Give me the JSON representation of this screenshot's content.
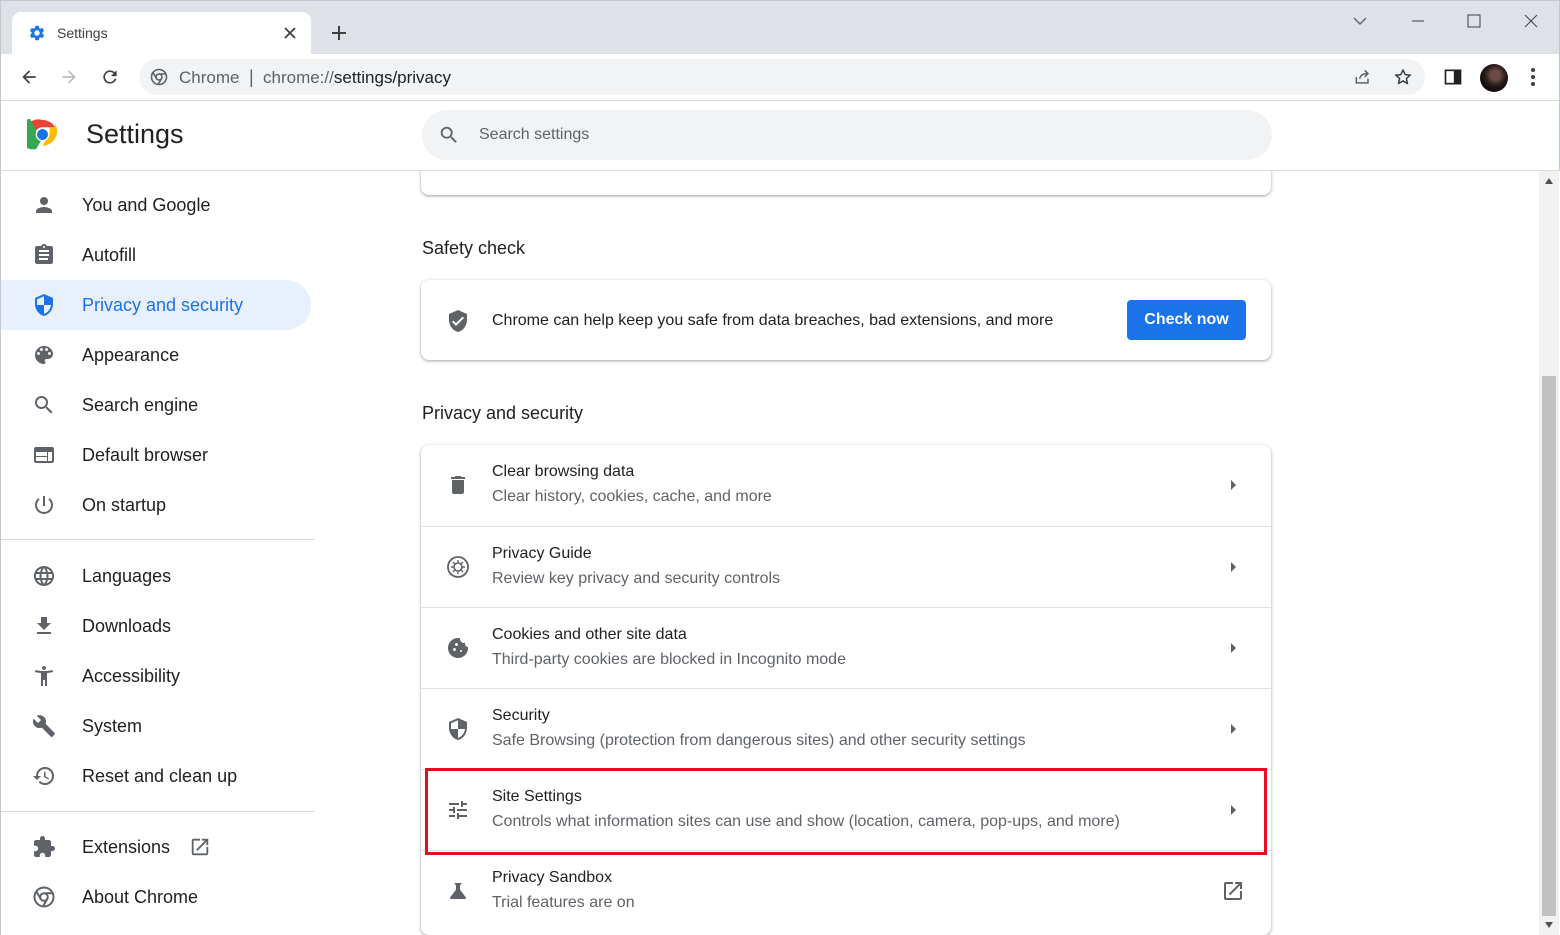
{
  "tab": {
    "title": "Settings",
    "favicon": "gear-icon"
  },
  "toolbar": {
    "site_name": "Chrome",
    "separator": "|",
    "url_scheme": "chrome://",
    "url_path": "settings/privacy"
  },
  "header": {
    "title": "Settings",
    "search_placeholder": "Search settings"
  },
  "sidebar": {
    "items": [
      {
        "label": "You and Google",
        "icon": "person-icon"
      },
      {
        "label": "Autofill",
        "icon": "clipboard-icon"
      },
      {
        "label": "Privacy and security",
        "icon": "shield-icon",
        "active": true
      },
      {
        "label": "Appearance",
        "icon": "palette-icon"
      },
      {
        "label": "Search engine",
        "icon": "search-icon"
      },
      {
        "label": "Default browser",
        "icon": "browser-window-icon"
      },
      {
        "label": "On startup",
        "icon": "power-icon"
      },
      {
        "label": "Languages",
        "icon": "globe-icon"
      },
      {
        "label": "Downloads",
        "icon": "download-icon"
      },
      {
        "label": "Accessibility",
        "icon": "accessibility-icon"
      },
      {
        "label": "System",
        "icon": "wrench-icon"
      },
      {
        "label": "Reset and clean up",
        "icon": "restore-icon"
      },
      {
        "label": "Extensions",
        "icon": "puzzle-icon"
      },
      {
        "label": "About Chrome",
        "icon": "chrome-logo-icon"
      }
    ]
  },
  "safety_check": {
    "title": "Safety check",
    "text": "Chrome can help keep you safe from data breaches, bad extensions, and more",
    "button": "Check now",
    "button_color": "#1a73e8"
  },
  "privacy": {
    "title": "Privacy and security",
    "rows": [
      {
        "title": "Clear browsing data",
        "subtitle": "Clear history, cookies, cache, and more",
        "icon": "trash-icon"
      },
      {
        "title": "Privacy Guide",
        "subtitle": "Review key privacy and security controls",
        "icon": "compass-icon"
      },
      {
        "title": "Cookies and other site data",
        "subtitle": "Third-party cookies are blocked in Incognito mode",
        "icon": "cookie-icon"
      },
      {
        "title": "Security",
        "subtitle": "Safe Browsing (protection from dangerous sites) and other security settings",
        "icon": "shield-icon"
      },
      {
        "title": "Site Settings",
        "subtitle": "Controls what information sites can use and show (location, camera, pop-ups, and more)",
        "icon": "tune-icon",
        "highlighted": true
      },
      {
        "title": "Privacy Sandbox",
        "subtitle": "Trial features are on",
        "icon": "flask-icon"
      }
    ]
  },
  "colors": {
    "accent": "#1a73e8",
    "active_nav_bg": "#e8f0fe",
    "highlight_box": "#e0101e"
  }
}
